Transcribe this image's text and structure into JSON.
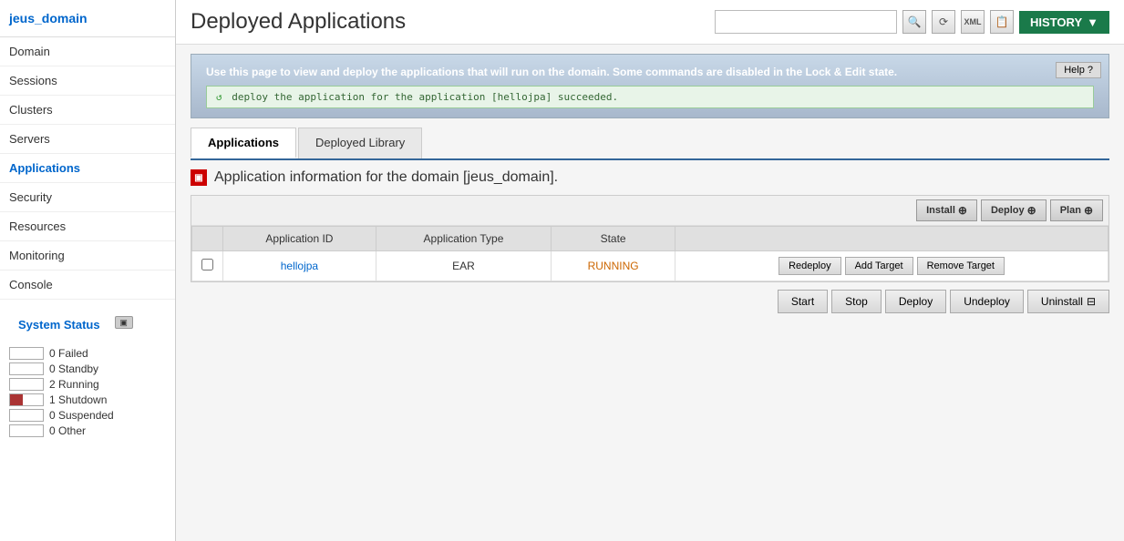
{
  "sidebar": {
    "domain_name": "jeus_domain",
    "nav_items": [
      {
        "id": "domain",
        "label": "Domain",
        "active": false
      },
      {
        "id": "sessions",
        "label": "Sessions",
        "active": false
      },
      {
        "id": "clusters",
        "label": "Clusters",
        "active": false
      },
      {
        "id": "servers",
        "label": "Servers",
        "active": false
      },
      {
        "id": "applications",
        "label": "Applications",
        "active": true
      },
      {
        "id": "security",
        "label": "Security",
        "active": false
      },
      {
        "id": "resources",
        "label": "Resources",
        "active": false
      },
      {
        "id": "monitoring",
        "label": "Monitoring",
        "active": false
      },
      {
        "id": "console",
        "label": "Console",
        "active": false
      }
    ],
    "system_status": {
      "title": "System Status",
      "items": [
        {
          "id": "failed",
          "count": "0 Failed",
          "bar_type": "empty"
        },
        {
          "id": "standby",
          "count": "0 Standby",
          "bar_type": "empty"
        },
        {
          "id": "running",
          "count": "2 Running",
          "bar_type": "running"
        },
        {
          "id": "shutdown",
          "count": "1 Shutdown",
          "bar_type": "shutdown"
        },
        {
          "id": "suspended",
          "count": "0 Suspended",
          "bar_type": "empty"
        },
        {
          "id": "other",
          "count": "0 Other",
          "bar_type": "empty"
        }
      ]
    }
  },
  "header": {
    "title": "Deployed Applications",
    "search_placeholder": "",
    "history_label": "HISTORY"
  },
  "info_banner": {
    "text": "Use this page to view and deploy the applications that will run on the domain. Some commands are disabled in the Lock & Edit state.",
    "help_label": "Help",
    "success_message": "deploy the application for the application [hellojpa] succeeded."
  },
  "tabs": [
    {
      "id": "applications",
      "label": "Applications",
      "active": true
    },
    {
      "id": "deployed-library",
      "label": "Deployed Library",
      "active": false
    }
  ],
  "section_title": "Application information for the domain [jeus_domain].",
  "table": {
    "toolbar_buttons": [
      {
        "id": "install",
        "label": "Install"
      },
      {
        "id": "deploy",
        "label": "Deploy"
      },
      {
        "id": "plan",
        "label": "Plan"
      }
    ],
    "columns": [
      "",
      "Application ID",
      "Application Type",
      "State",
      ""
    ],
    "rows": [
      {
        "id": "hellojpa",
        "name": "hellojpa",
        "type": "EAR",
        "state": "RUNNING",
        "actions": [
          "Redeploy",
          "Add Target",
          "Remove Target"
        ]
      }
    ],
    "bottom_buttons": [
      "Start",
      "Stop",
      "Deploy",
      "Undeploy",
      "Uninstall"
    ]
  }
}
